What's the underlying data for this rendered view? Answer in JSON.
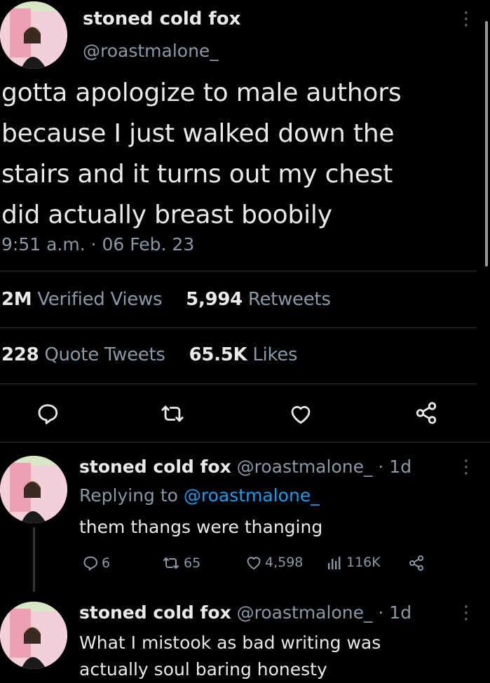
{
  "main_tweet": {
    "display_name": "stoned cold fox",
    "handle": "@roastmalone_",
    "text_lines": [
      "gotta apologize to male authors",
      "because I just walked down the",
      "stairs and it turns out my chest",
      "did actually breast boobily"
    ],
    "timestamp": "9:51 a.m. · 06 Feb. 23",
    "stats": {
      "views_count": "2M",
      "views_label": "Verified Views",
      "retweets_count": "5,994",
      "retweets_label": "Retweets",
      "quotes_count": "228",
      "quotes_label": "Quote Tweets",
      "likes_count": "65.5K",
      "likes_label": "Likes"
    },
    "actions": [
      "reply-icon",
      "retweet-icon",
      "like-icon",
      "share-icon"
    ]
  },
  "replies": [
    {
      "display_name": "stoned cold fox",
      "handle_time": "@roastmalone_ · 1d",
      "replying_prefix": "Replying to ",
      "replying_handle": "@roastmalone_",
      "text": "them thangs were thanging",
      "counts": {
        "replies": "6",
        "retweets": "65",
        "likes": "4,598",
        "views": "116K"
      }
    },
    {
      "display_name": "stoned cold fox",
      "handle_time": "@roastmalone_ · 1d",
      "text_lines": [
        "What I mistook as bad writing was",
        "actually soul baring honesty"
      ]
    }
  ],
  "colors": {
    "background": "#000000",
    "text": "#e7e9ea",
    "secondary": "#8b98a5",
    "link": "#1d9bf0",
    "divider": "#2f3336"
  }
}
